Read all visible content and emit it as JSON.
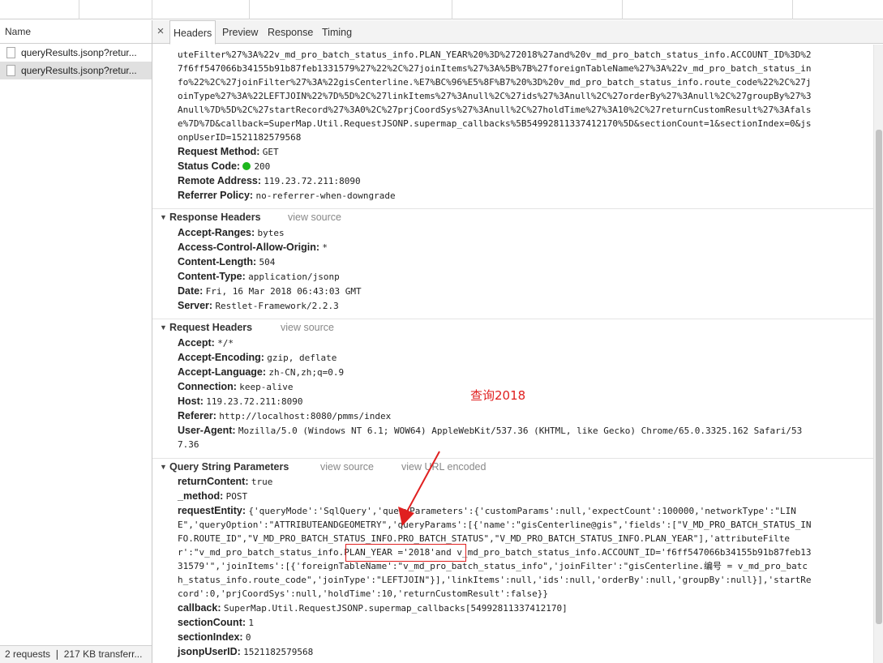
{
  "left_panel": {
    "header": "Name",
    "requests": [
      "queryResults.jsonp?retur...",
      "queryResults.jsonp?retur..."
    ],
    "footer": "2 requests ❘ 217 KB transferr..."
  },
  "tabs": {
    "close": "×",
    "items": [
      "Headers",
      "Preview",
      "Response",
      "Timing"
    ]
  },
  "general": {
    "url_lines": [
      "uteFilter%27%3A%22v_md_pro_batch_status_info.PLAN_YEAR%20%3D%272018%27and%20v_md_pro_batch_status_info.ACCOUNT_ID%3D%2",
      "7f6ff547066b34155b91b87feb1331579%27%22%2C%27joinItems%27%3A%5B%7B%27foreignTableName%27%3A%22v_md_pro_batch_status_in",
      "fo%22%2C%27joinFilter%27%3A%22gisCenterline.%E7%BC%96%E5%8F%B7%20%3D%20v_md_pro_batch_status_info.route_code%22%2C%27j",
      "oinType%27%3A%22LEFTJOIN%22%7D%5D%2C%27linkItems%27%3Anull%2C%27ids%27%3Anull%2C%27orderBy%27%3Anull%2C%27groupBy%27%3",
      "Anull%7D%5D%2C%27startRecord%27%3A0%2C%27prjCoordSys%27%3Anull%2C%27holdTime%27%3A10%2C%27returnCustomResult%27%3Afals",
      "e%7D%7D&callback=SuperMap.Util.RequestJSONP.supermap_callbacks%5B54992811337412170%5D&sectionCount=1&sectionIndex=0&js",
      "onpUserID=1521182579568"
    ],
    "method_k": "Request Method:",
    "method_v": "GET",
    "status_k": "Status Code:",
    "status_v": "200",
    "remote_k": "Remote Address:",
    "remote_v": "119.23.72.211:8090",
    "referrer_k": "Referrer Policy:",
    "referrer_v": "no-referrer-when-downgrade"
  },
  "response_headers": {
    "title": "Response Headers",
    "view_source": "view source",
    "rows": [
      {
        "k": "Accept-Ranges:",
        "v": "bytes"
      },
      {
        "k": "Access-Control-Allow-Origin:",
        "v": "*"
      },
      {
        "k": "Content-Length:",
        "v": "504"
      },
      {
        "k": "Content-Type:",
        "v": "application/jsonp"
      },
      {
        "k": "Date:",
        "v": "Fri, 16 Mar 2018 06:43:03 GMT"
      },
      {
        "k": "Server:",
        "v": "Restlet-Framework/2.2.3"
      }
    ]
  },
  "request_headers": {
    "title": "Request Headers",
    "view_source": "view source",
    "rows": [
      {
        "k": "Accept:",
        "v": "*/*"
      },
      {
        "k": "Accept-Encoding:",
        "v": "gzip, deflate"
      },
      {
        "k": "Accept-Language:",
        "v": "zh-CN,zh;q=0.9"
      },
      {
        "k": "Connection:",
        "v": "keep-alive"
      },
      {
        "k": "Host:",
        "v": "119.23.72.211:8090"
      },
      {
        "k": "Referer:",
        "v": "http://localhost:8080/pmms/index"
      }
    ],
    "ua_k": "User-Agent:",
    "ua_v1": "Mozilla/5.0 (Windows NT 6.1; WOW64) AppleWebKit/537.36 (KHTML, like Gecko) Chrome/65.0.3325.162 Safari/53",
    "ua_v2": "7.36"
  },
  "query_params": {
    "title": "Query String Parameters",
    "view_source": "view source",
    "view_url": "view URL encoded",
    "returnContent_k": "returnContent:",
    "returnContent_v": "true",
    "method_k": "_method:",
    "method_v": "POST",
    "requestEntity_k": "requestEntity:",
    "requestEntity_lines": [
      "{'queryMode':'SqlQuery','queryParameters':{'customParams':null,'expectCount':100000,'networkType':\"LIN",
      "E\",'queryOption':\"ATTRIBUTEANDGEOMETRY\",'queryParams':[{'name':\"gisCenterline@gis\",'fields':[\"V_MD_PRO_BATCH_STATUS_IN",
      "FO.ROUTE_ID\",\"V_MD_PRO_BATCH_STATUS_INFO.PRO_BATCH_STATUS\",\"V_MD_PRO_BATCH_STATUS_INFO.PLAN_YEAR\"],'attributeFilte",
      "r':\"v_md_pro_batch_status_info.PLAN_YEAR ='2018'and v_md_pro_batch_status_info.ACCOUNT_ID='f6ff547066b34155b91b87feb13",
      "31579'\",'joinItems':[{'foreignTableName':\"v_md_pro_batch_status_info\",'joinFilter':\"gisCenterline.编号 = v_md_pro_batc",
      "h_status_info.route_code\",'joinType':\"LEFTJOIN\"}],'linkItems':null,'ids':null,'orderBy':null,'groupBy':null}],'startRe",
      "cord':0,'prjCoordSys':null,'holdTime':10,'returnCustomResult':false}}"
    ],
    "callback_k": "callback:",
    "callback_v": "SuperMap.Util.RequestJSONP.supermap_callbacks[54992811337412170]",
    "sectionCount_k": "sectionCount:",
    "sectionCount_v": "1",
    "sectionIndex_k": "sectionIndex:",
    "sectionIndex_v": "0",
    "jsonpUserID_k": "jsonpUserID:",
    "jsonpUserID_v": "1521182579568"
  },
  "annotation": {
    "text": "查询2018",
    "color": "#e02020"
  }
}
